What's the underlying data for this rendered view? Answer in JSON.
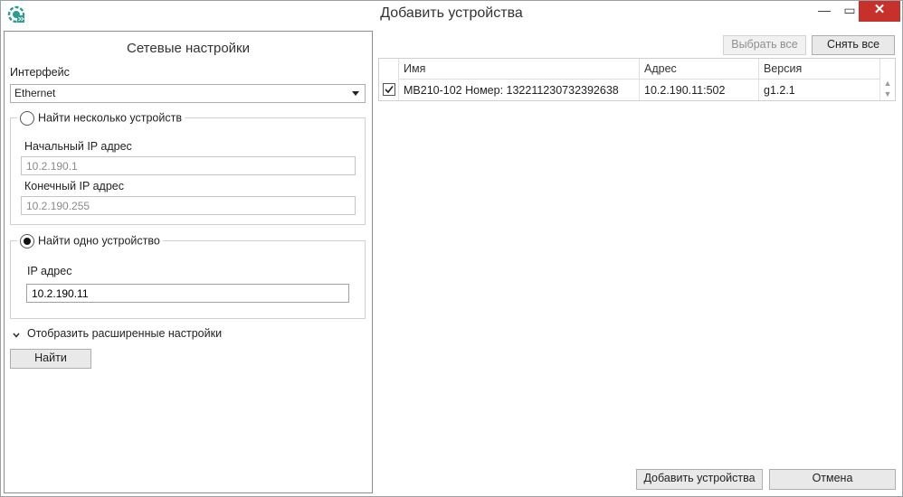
{
  "window": {
    "title": "Добавить устройства",
    "minimize_glyph": "—",
    "maximize_glyph": "▭",
    "close_glyph": "✕"
  },
  "network": {
    "title": "Сетевые настройки",
    "interface_label": "Интерфейс",
    "interface_value": "Ethernet",
    "multi": {
      "label": "Найти несколько устройств",
      "selected": false,
      "start_label": "Начальный IP адрес",
      "start_value": "10.2.190.1",
      "end_label": "Конечный IP адрес",
      "end_value": "10.2.190.255"
    },
    "single": {
      "label": "Найти одно устройство",
      "selected": true,
      "ip_label": "IP адрес",
      "ip_value": "10.2.190.11"
    },
    "advanced_label": "Отобразить расширенные настройки",
    "find_button": "Найти"
  },
  "toolbar": {
    "select_all": "Выбрать все",
    "deselect_all": "Снять все"
  },
  "table": {
    "columns": [
      "Имя",
      "Адрес",
      "Версия"
    ],
    "rows": [
      {
        "checked": true,
        "name": "МВ210-102 Номер: 132211230732392638",
        "address": "10.2.190.11:502",
        "version": "g1.2.1"
      }
    ]
  },
  "footer": {
    "add_button": "Добавить устройства",
    "cancel_button": "Отмена"
  },
  "colors": {
    "close_button": "#c7312b",
    "app_icon": "#2f9a8e"
  },
  "icons": [
    "app-logo-icon",
    "dropdown-arrow-icon",
    "chevron-down-icon",
    "checkbox-checked-icon",
    "scroll-up-icon",
    "scroll-down-icon"
  ]
}
